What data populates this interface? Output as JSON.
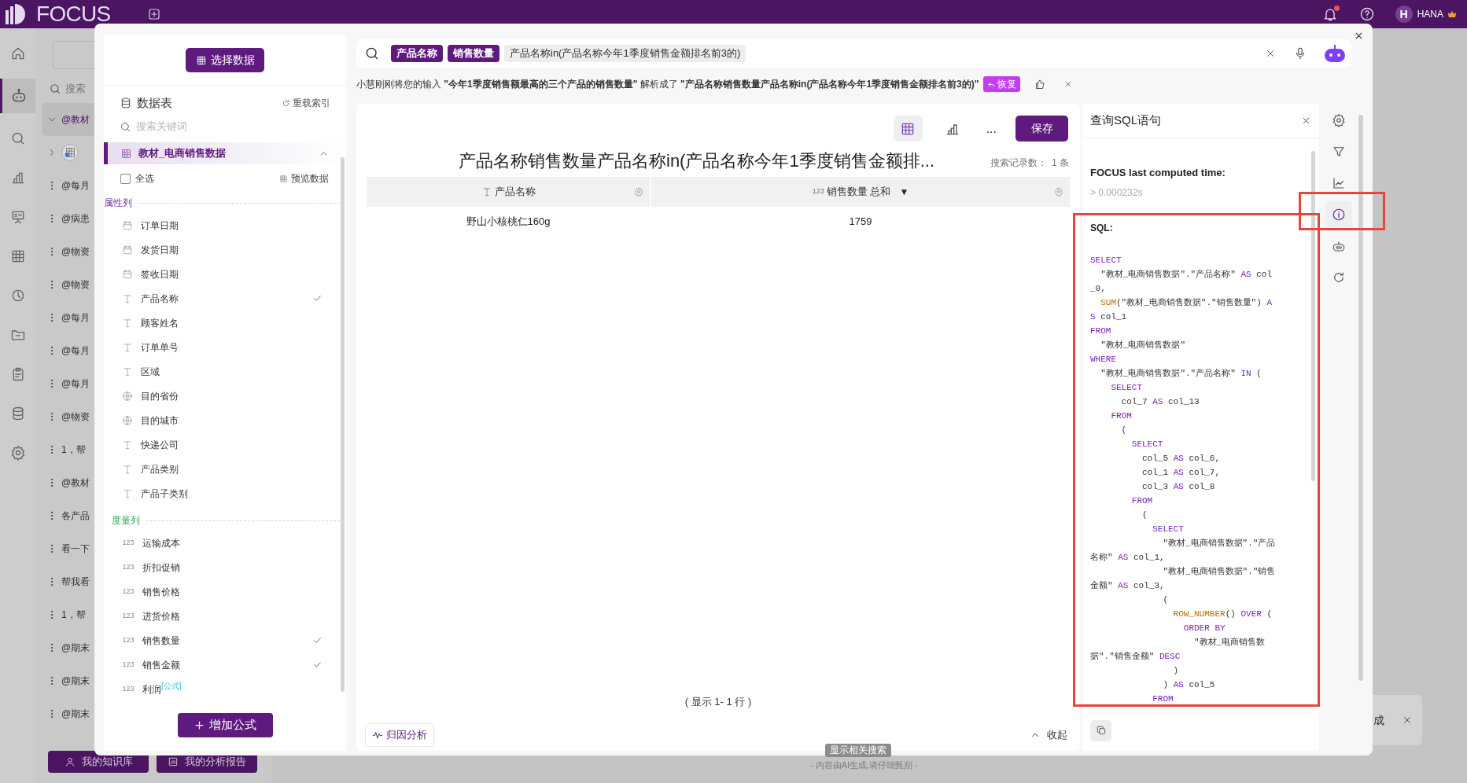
{
  "app_bar": {
    "logo": "FOCUS",
    "user_initial": "H",
    "user_name": "HANA",
    "has_notification": true
  },
  "nav_rail": [
    {
      "kind": "home",
      "selected": false
    },
    {
      "kind": "robot",
      "selected": true
    },
    {
      "kind": "search",
      "selected": false
    },
    {
      "kind": "bars",
      "selected": false
    },
    {
      "kind": "screen",
      "selected": false
    },
    {
      "kind": "table",
      "selected": false
    },
    {
      "kind": "clock",
      "selected": false
    },
    {
      "kind": "folder",
      "selected": false
    },
    {
      "kind": "clipboard",
      "selected": false
    },
    {
      "kind": "database",
      "selected": false
    },
    {
      "kind": "gear",
      "selected": false
    }
  ],
  "history": {
    "search_placeholder": "搜索",
    "items": [
      {
        "kind": "group",
        "text": "@教材",
        "expanded": true,
        "selected": true
      },
      {
        "kind": "dataset",
        "expanded": false,
        "selected": false
      },
      {
        "kind": "query",
        "text": "@每月",
        "selected": false
      },
      {
        "kind": "query",
        "text": "@病患",
        "selected": false
      },
      {
        "kind": "query",
        "text": "@物资",
        "selected": false
      },
      {
        "kind": "query",
        "text": "@物资",
        "selected": false
      },
      {
        "kind": "query",
        "text": "@每月",
        "selected": false
      },
      {
        "kind": "query",
        "text": "@每月",
        "selected": false
      },
      {
        "kind": "query",
        "text": "@每月",
        "selected": false
      },
      {
        "kind": "query",
        "text": "@物资",
        "selected": false
      },
      {
        "kind": "query",
        "text": "1，帮",
        "selected": false
      },
      {
        "kind": "query",
        "text": "@教材",
        "selected": false
      },
      {
        "kind": "query",
        "text": "各产品",
        "selected": false
      },
      {
        "kind": "query",
        "text": "看一下",
        "selected": false
      },
      {
        "kind": "query",
        "text": "帮我看",
        "selected": false
      },
      {
        "kind": "query",
        "text": "1，帮",
        "selected": false
      },
      {
        "kind": "query",
        "text": "@期末",
        "selected": false
      },
      {
        "kind": "query",
        "text": "@期末",
        "selected": false
      },
      {
        "kind": "query",
        "text": "@期末",
        "selected": false
      }
    ],
    "buttons": [
      {
        "kind": "user",
        "label": "我的知识库"
      },
      {
        "kind": "report",
        "label": "我的分析报告"
      }
    ]
  },
  "toast": {
    "text": "成"
  },
  "related_search_tag": "显示相关搜索",
  "disclaimer": "- 内容由AI生成,请仔细甄别 -",
  "data_panel": {
    "select_button": "选择数据",
    "title": "数据表",
    "reload": "重载索引",
    "search_placeholder": "搜索关键词",
    "table": {
      "name": "教材_电商销售数据",
      "expanded": true,
      "selected": true
    },
    "select_all": {
      "label": "全选",
      "checked": false
    },
    "preview": "预览数据",
    "groups": [
      {
        "kind": "attribute",
        "title": "属性列",
        "fields": [
          {
            "kind": "date",
            "label": "订单日期",
            "checked": false
          },
          {
            "kind": "date",
            "label": "发货日期",
            "checked": false
          },
          {
            "kind": "date",
            "label": "签收日期",
            "checked": false
          },
          {
            "kind": "text",
            "label": "产品名称",
            "checked": true
          },
          {
            "kind": "text",
            "label": "顾客姓名",
            "checked": false
          },
          {
            "kind": "text",
            "label": "订单单号",
            "checked": false
          },
          {
            "kind": "text",
            "label": "区域",
            "checked": false
          },
          {
            "kind": "geo",
            "label": "目的省份",
            "checked": false
          },
          {
            "kind": "geo",
            "label": "目的城市",
            "checked": false
          },
          {
            "kind": "text",
            "label": "快递公司",
            "checked": false
          },
          {
            "kind": "text",
            "label": "产品类别",
            "checked": false
          },
          {
            "kind": "text",
            "label": "产品子类别",
            "checked": false
          }
        ]
      },
      {
        "kind": "measure",
        "title": "度量列",
        "fields": [
          {
            "kind": "number",
            "icon_text": "123",
            "label": "运输成本",
            "checked": false
          },
          {
            "kind": "number",
            "icon_text": "123",
            "label": "折扣促销",
            "checked": false
          },
          {
            "kind": "number",
            "icon_text": "123",
            "label": "销售价格",
            "checked": false
          },
          {
            "kind": "number",
            "icon_text": "123",
            "label": "进货价格",
            "checked": false
          },
          {
            "kind": "number",
            "icon_text": "123",
            "label": "销售数量",
            "checked": true
          },
          {
            "kind": "number",
            "icon_text": "123",
            "label": "销售金额",
            "checked": true
          },
          {
            "kind": "number",
            "icon_text": "123",
            "label": "利润$^{[公式]}$",
            "checked": false
          }
        ]
      }
    ],
    "add_formula": "增加公式"
  },
  "search_bar": {
    "tokens": [
      {
        "kind": "column",
        "text": "产品名称"
      },
      {
        "kind": "column",
        "text": "销售数量"
      },
      {
        "kind": "filter",
        "text": "产品名称in(产品名称今年1季度销售金额排名前3的)"
      }
    ]
  },
  "parse_notice": {
    "text": "小慧刚刚将您的输入 **\"今年1季度销售额最高的三个产品的销售数量\"** 解析成了 **\"产品名称销售数量产品名称in(产品名称今年1季度销售金额排名前3的)\"**",
    "restore": "恢复"
  },
  "result": {
    "view_modes": [
      {
        "kind": "table",
        "selected": true
      },
      {
        "kind": "chart",
        "selected": false
      }
    ],
    "more": "...",
    "save": "保存",
    "title": "产品名称销售数量产品名称in(产品名称今年1季度销售金额排...",
    "record_label": "搜索记录数：",
    "record_count": "1 条",
    "columns": [
      {
        "kind": "text",
        "label": "产品名称"
      },
      {
        "kind": "number",
        "icon_text": "123",
        "label": "销售数量 总和",
        "sort_marker": "▼"
      }
    ],
    "rows": [
      [
        "野山小核桃仁160g",
        "1759"
      ]
    ],
    "footer": "( 显示 1- 1 行 )",
    "attribution": "归因分析",
    "collapse": "收起"
  },
  "sql_panel": {
    "title": "查询SQL语句",
    "time_label": "FOCUS last computed time:",
    "time_value": "> 0.000232s",
    "sql_label": "SQL:",
    "lines": [
      [
        {
          "kind": "keyword",
          "text": "SELECT"
        }
      ],
      [
        {
          "kind": "plain",
          "text": "  \"教材_电商销售数据\".\"产品名称\" "
        },
        {
          "kind": "keyword",
          "text": "AS"
        },
        {
          "kind": "plain",
          "text": " col"
        }
      ],
      [
        {
          "kind": "plain",
          "text": "_0,"
        }
      ],
      [
        {
          "kind": "function",
          "text": "  SUM"
        },
        {
          "kind": "plain",
          "text": "(\"教材_电商销售数据\".\"销售数量\") "
        },
        {
          "kind": "keyword",
          "text": "A"
        }
      ],
      [
        {
          "kind": "keyword",
          "text": "S"
        },
        {
          "kind": "plain",
          "text": " col_1"
        }
      ],
      [
        {
          "kind": "keyword",
          "text": "FROM"
        }
      ],
      [
        {
          "kind": "plain",
          "text": "  \"教材_电商销售数据\""
        }
      ],
      [
        {
          "kind": "keyword",
          "text": "WHERE"
        }
      ],
      [
        {
          "kind": "plain",
          "text": "  \"教材_电商销售数据\".\"产品名称\" "
        },
        {
          "kind": "keyword",
          "text": "IN"
        },
        {
          "kind": "plain",
          "text": " ("
        }
      ],
      [
        {
          "kind": "keyword",
          "text": "    SELECT"
        }
      ],
      [
        {
          "kind": "plain",
          "text": "      col_7 "
        },
        {
          "kind": "keyword",
          "text": "AS"
        },
        {
          "kind": "plain",
          "text": " col_13"
        }
      ],
      [
        {
          "kind": "keyword",
          "text": "    FROM"
        }
      ],
      [
        {
          "kind": "plain",
          "text": "      ("
        }
      ],
      [
        {
          "kind": "keyword",
          "text": "        SELECT"
        }
      ],
      [
        {
          "kind": "plain",
          "text": "          col_5 "
        },
        {
          "kind": "keyword",
          "text": "AS"
        },
        {
          "kind": "plain",
          "text": " col_6,"
        }
      ],
      [
        {
          "kind": "plain",
          "text": "          col_1 "
        },
        {
          "kind": "keyword",
          "text": "AS"
        },
        {
          "kind": "plain",
          "text": " col_7,"
        }
      ],
      [
        {
          "kind": "plain",
          "text": "          col_3 "
        },
        {
          "kind": "keyword",
          "text": "AS"
        },
        {
          "kind": "plain",
          "text": " col_8"
        }
      ],
      [
        {
          "kind": "keyword",
          "text": "        FROM"
        }
      ],
      [
        {
          "kind": "plain",
          "text": "          ("
        }
      ],
      [
        {
          "kind": "keyword",
          "text": "            SELECT"
        }
      ],
      [
        {
          "kind": "plain",
          "text": "              \"教材_电商销售数据\".\"产品"
        }
      ],
      [
        {
          "kind": "plain",
          "text": "名称\" "
        },
        {
          "kind": "keyword",
          "text": "AS"
        },
        {
          "kind": "plain",
          "text": " col_1,"
        }
      ],
      [
        {
          "kind": "plain",
          "text": "              \"教材_电商销售数据\".\"销售"
        }
      ],
      [
        {
          "kind": "plain",
          "text": "金额\" "
        },
        {
          "kind": "keyword",
          "text": "AS"
        },
        {
          "kind": "plain",
          "text": " col_3,"
        }
      ],
      [
        {
          "kind": "plain",
          "text": "              ("
        }
      ],
      [
        {
          "kind": "function",
          "text": "                ROW_NUMBER"
        },
        {
          "kind": "plain",
          "text": "() "
        },
        {
          "kind": "keyword",
          "text": "OVER"
        },
        {
          "kind": "plain",
          "text": " ("
        }
      ],
      [
        {
          "kind": "keyword",
          "text": "                  ORDER BY"
        }
      ],
      [
        {
          "kind": "plain",
          "text": "                    \"教材_电商销售数"
        }
      ],
      [
        {
          "kind": "plain",
          "text": "据\".\"销售金额\" "
        },
        {
          "kind": "keyword",
          "text": "DESC"
        }
      ],
      [
        {
          "kind": "plain",
          "text": "                )"
        }
      ],
      [
        {
          "kind": "plain",
          "text": "              ) "
        },
        {
          "kind": "keyword",
          "text": "AS"
        },
        {
          "kind": "plain",
          "text": " col_5"
        }
      ],
      [
        {
          "kind": "keyword",
          "text": "            FROM"
        }
      ]
    ],
    "highlighted": true
  },
  "tool_rail": [
    {
      "kind": "gear",
      "selected": false
    },
    {
      "kind": "filter",
      "selected": false
    },
    {
      "kind": "trend",
      "selected": false
    },
    {
      "kind": "info",
      "selected": true,
      "highlighted": true
    },
    {
      "kind": "bot",
      "selected": false
    },
    {
      "kind": "refresh",
      "selected": false
    }
  ]
}
